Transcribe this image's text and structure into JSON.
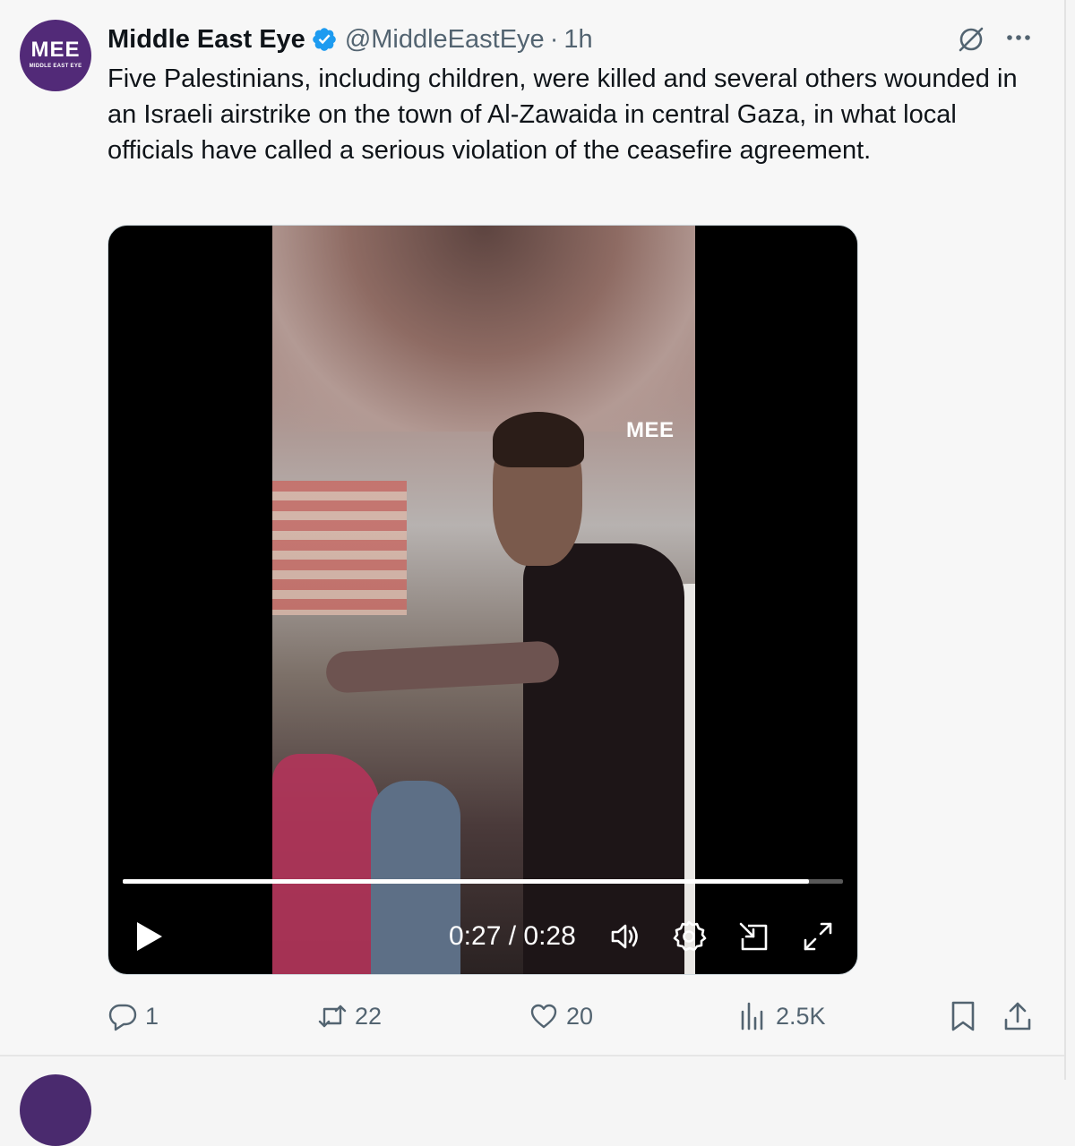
{
  "tweet": {
    "author_name": "Middle East Eye",
    "handle": "@MiddleEastEye",
    "separator": "·",
    "time": "1h",
    "avatar_logo": "MEE",
    "avatar_subtext": "MIDDLE EAST EYE",
    "text": "Five Palestinians, including children, were killed and several others wounded in an Israeli airstrike on the town of Al-Zawaida in central Gaza, in what local officials have called a serious violation of the ceasefire agreement."
  },
  "video": {
    "watermark": "MEE",
    "time_display": "0:27 / 0:28",
    "progress_fraction": 0.953,
    "icons": [
      "play-icon",
      "volume-icon",
      "settings-gear-icon",
      "picture-in-picture-icon",
      "fullscreen-icon"
    ]
  },
  "actions": {
    "replies": "1",
    "reposts": "22",
    "likes": "20",
    "views": "2.5K"
  },
  "colors": {
    "verified": "#1d9bf0",
    "muted_text": "#536471",
    "avatar_bg": "#522a78",
    "text": "#0f1419"
  }
}
